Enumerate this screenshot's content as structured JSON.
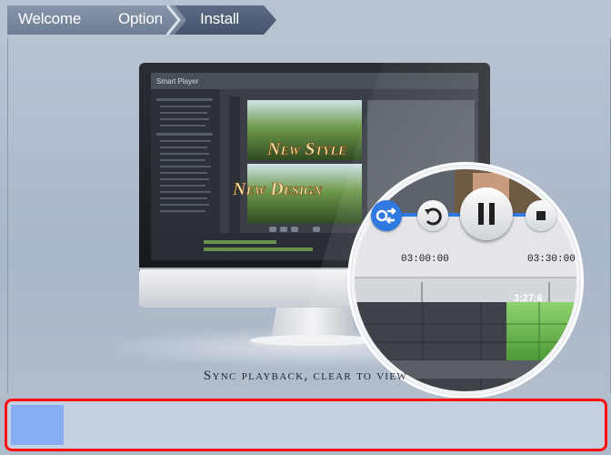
{
  "steps": [
    {
      "label": "Welcome",
      "active": false
    },
    {
      "label": "Option",
      "active": false
    },
    {
      "label": "Install",
      "active": true
    }
  ],
  "screen": {
    "app_title": "Smart Player",
    "promo_line_1": "New Style",
    "promo_line_2": "New Design"
  },
  "magnifier": {
    "time_marks": [
      "03:00:00",
      "03:30:00"
    ],
    "clip_time": "3:27:6",
    "controls": [
      "sync-icon",
      "undo-icon",
      "pause-icon",
      "stop-icon"
    ]
  },
  "caption": "Sync playback, clear to view",
  "progress": {
    "fraction": 0.09
  },
  "colors": {
    "highlight_border": "#ff1010",
    "progress_fill": "#87aef2",
    "accent_blue": "#2f79e0"
  }
}
